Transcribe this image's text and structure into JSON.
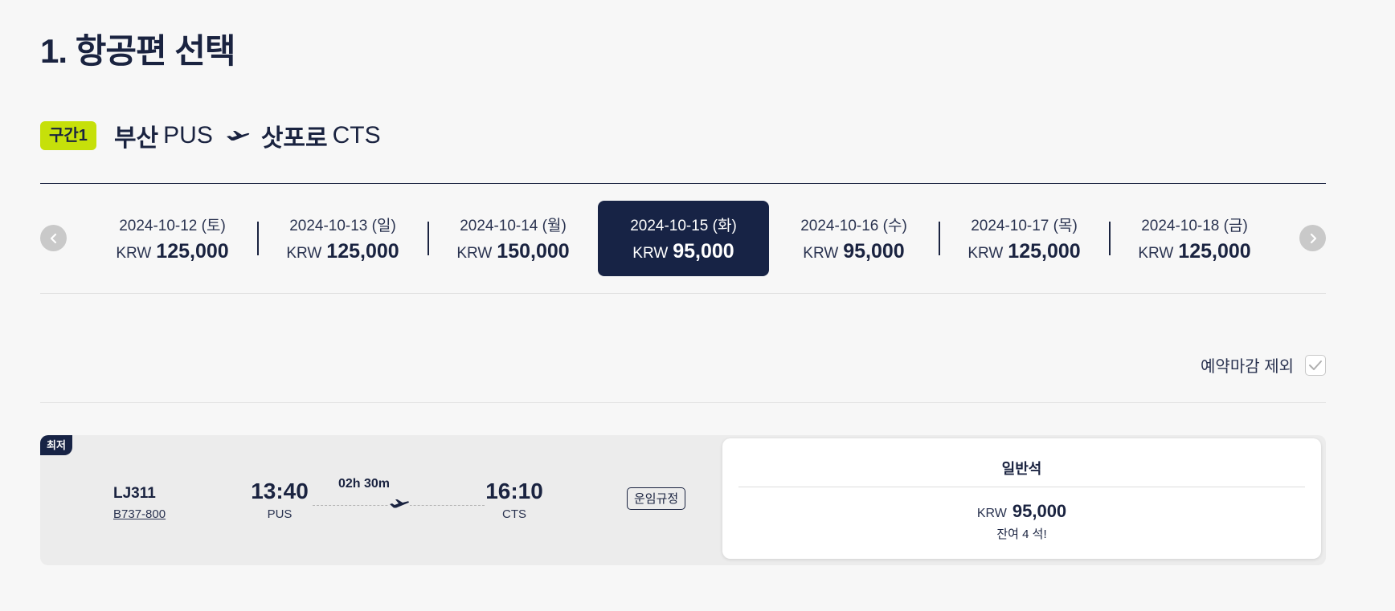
{
  "page": {
    "title": "1. 항공편 선택"
  },
  "segment": {
    "badge": "구간1",
    "origin_city": "부산",
    "origin_code": "PUS",
    "destination_city": "삿포로",
    "destination_code": "CTS",
    "route_icon": "airplane-icon"
  },
  "date_strip": {
    "prev_icon": "chevron-left-icon",
    "next_icon": "chevron-right-icon",
    "dates": [
      {
        "date": "2024-10-12 (토)",
        "currency": "KRW",
        "price": "125,000"
      },
      {
        "date": "2024-10-13 (일)",
        "currency": "KRW",
        "price": "125,000"
      },
      {
        "date": "2024-10-14 (월)",
        "currency": "KRW",
        "price": "150,000"
      },
      {
        "date": "2024-10-15 (화)",
        "currency": "KRW",
        "price": "95,000"
      },
      {
        "date": "2024-10-16 (수)",
        "currency": "KRW",
        "price": "95,000"
      },
      {
        "date": "2024-10-17 (목)",
        "currency": "KRW",
        "price": "125,000"
      },
      {
        "date": "2024-10-18 (금)",
        "currency": "KRW",
        "price": "125,000"
      }
    ],
    "selected_date": "2024-10-15 (화)"
  },
  "filter": {
    "exclude_closed_label": "예약마감 제외",
    "exclude_closed_checked": true
  },
  "flights": [
    {
      "badge": "최저",
      "flight_number": "LJ311",
      "aircraft": "B737-800",
      "departure_time": "13:40",
      "departure_airport": "PUS",
      "duration": "02h 30m",
      "arrival_time": "16:10",
      "arrival_airport": "CTS",
      "fare_rule_label": "운임규정",
      "fare": {
        "class_name": "일반석",
        "currency": "KRW",
        "price": "95,000",
        "seats_left": "잔여 4 석!"
      }
    }
  ],
  "colors": {
    "navy": "#172345",
    "accent_lime": "#c6e00a",
    "background": "#f7f7f7",
    "card_background": "#ececec"
  }
}
